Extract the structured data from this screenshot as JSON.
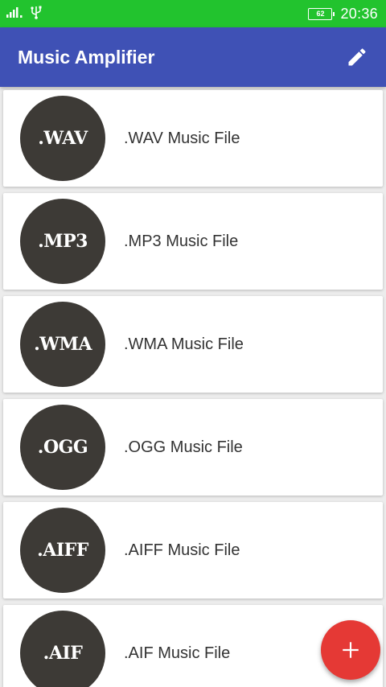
{
  "status_bar": {
    "time": "20:36",
    "battery_level": "62",
    "signal_icon": "signal-bars-icon",
    "usb_icon": "usb-icon"
  },
  "app_bar": {
    "title": "Music Amplifier",
    "edit_icon": "pencil-icon"
  },
  "colors": {
    "status_bar": "#22c32e",
    "app_bar": "#3f51b5",
    "badge": "#3d3a36",
    "fab": "#e53935"
  },
  "files": [
    {
      "badge": ".WAV",
      "label": ".WAV Music File"
    },
    {
      "badge": ".MP3",
      "label": ".MP3 Music File"
    },
    {
      "badge": ".WMA",
      "label": ".WMA Music File"
    },
    {
      "badge": ".OGG",
      "label": ".OGG Music File"
    },
    {
      "badge": ".AIFF",
      "label": ".AIFF Music File"
    },
    {
      "badge": ".AIF",
      "label": ".AIF Music File"
    }
  ],
  "fab": {
    "icon": "plus-icon",
    "label": "+"
  }
}
